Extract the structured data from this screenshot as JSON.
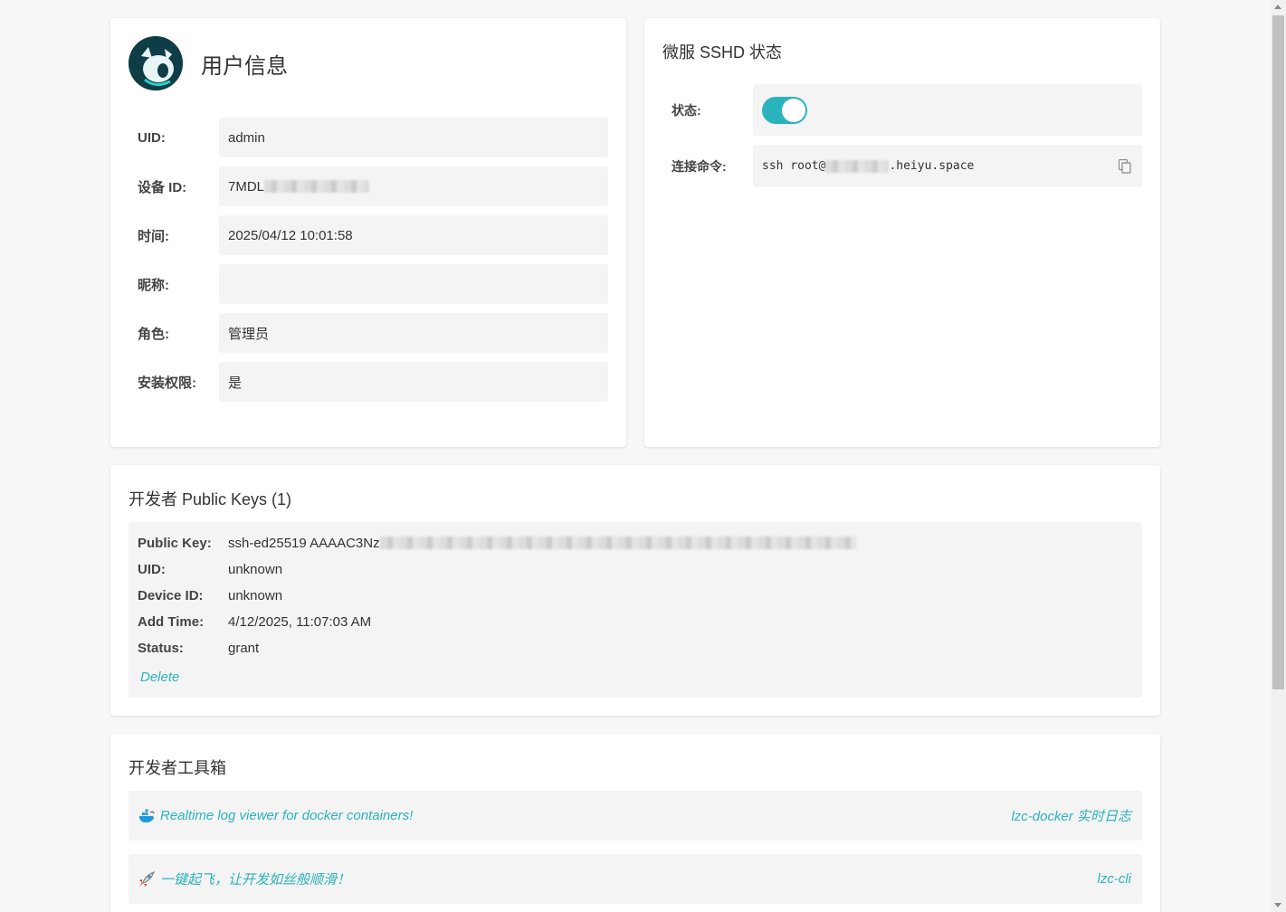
{
  "user_info": {
    "title": "用户信息",
    "fields": [
      {
        "label": "UID:",
        "value": "admin"
      },
      {
        "label": "设备 ID:",
        "value": "7MDL"
      },
      {
        "label": "时间:",
        "value": "2025/04/12 10:01:58"
      },
      {
        "label": "昵称:",
        "value": ""
      },
      {
        "label": "角色:",
        "value": "管理员"
      },
      {
        "label": "安装权限:",
        "value": "是"
      }
    ]
  },
  "sshd": {
    "title": "微服 SSHD 状态",
    "status_label": "状态:",
    "status_on": true,
    "command_label": "连接命令:",
    "command_prefix": "ssh root@",
    "command_suffix": ".heiyu.space",
    "accent_color": "#2bb3bd"
  },
  "public_keys": {
    "title": "开发者 Public Keys (1)",
    "entry": {
      "public_key_label": "Public Key:",
      "public_key_value": "ssh-ed25519 AAAAC3Nz",
      "uid_label": "UID:",
      "uid_value": "unknown",
      "device_label": "Device ID:",
      "device_value": "unknown",
      "add_time_label": "Add Time:",
      "add_time_value": "4/12/2025, 11:07:03 AM",
      "status_label": "Status:",
      "status_value": "grant"
    },
    "delete_label": "Delete"
  },
  "toolbox": {
    "title": "开发者工具箱",
    "items": [
      {
        "icon": "docker-whale-icon",
        "desc": "Realtime log viewer for docker containers!",
        "link": "lzc-docker 实时日志"
      },
      {
        "icon": "rocket-icon",
        "desc": "一键起飞，让开发如丝般顺滑！",
        "link": "lzc-cli"
      }
    ]
  }
}
